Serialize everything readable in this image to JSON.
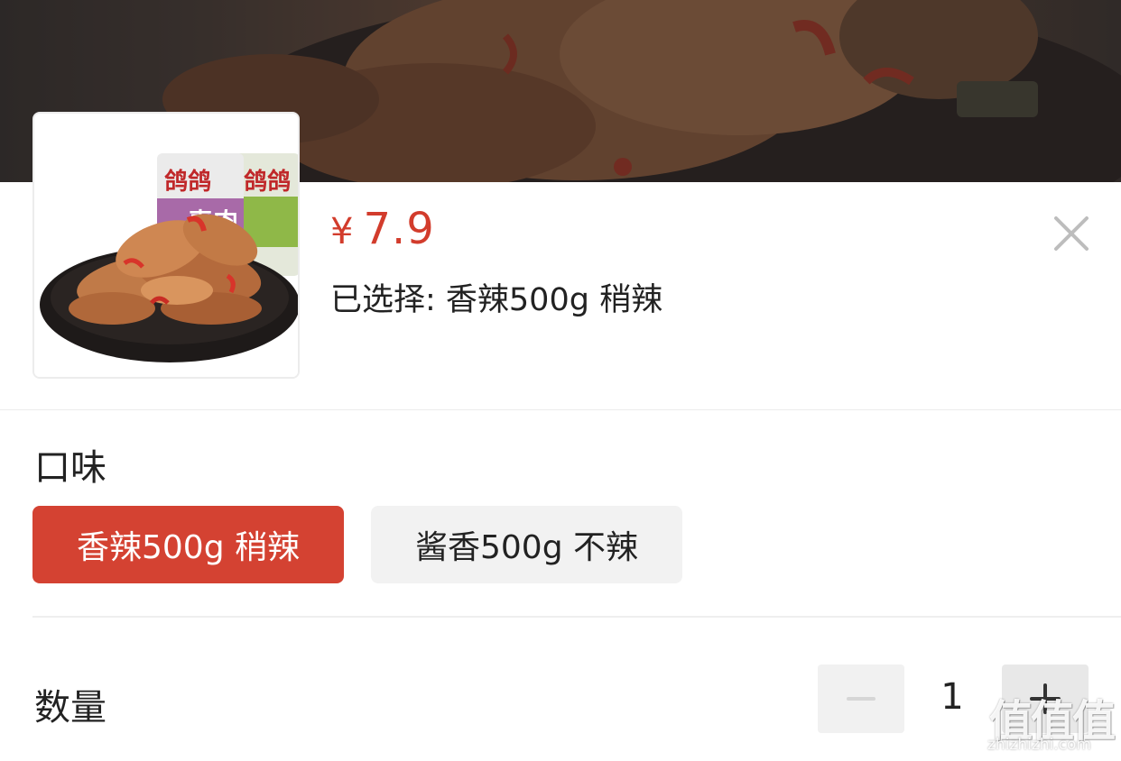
{
  "product": {
    "price_symbol": "¥",
    "price_value": "7.9",
    "selected_text": "已选择: 香辣500g 稍辣"
  },
  "flavor_section": {
    "title": "口味",
    "options": [
      {
        "label": "香辣500g 稍辣",
        "state": "selected"
      },
      {
        "label": "酱香500g 不辣",
        "state": "unselected"
      }
    ]
  },
  "quantity": {
    "label": "数量",
    "value": "1"
  },
  "package_brand": "鸽鸽",
  "package_product": "素肉",
  "watermark": {
    "glyphs": "值值值",
    "domain": "zhizhizhi.com"
  },
  "colors": {
    "accent": "#d44232",
    "price": "#d23c2c",
    "inactive_option_bg": "#f2f2f2",
    "text": "#222222"
  },
  "icons": {
    "close": "close-icon",
    "minus": "minus-icon",
    "plus": "plus-icon"
  }
}
